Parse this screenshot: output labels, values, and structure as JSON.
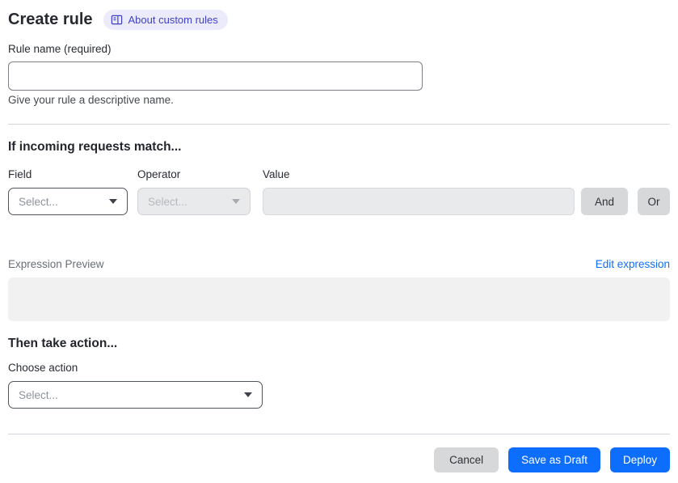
{
  "page": {
    "title": "Create rule",
    "about_badge": {
      "label": "About custom rules",
      "icon": "book-icon"
    }
  },
  "colors": {
    "accent_blue": "#0d6efd",
    "link_blue": "#0d6efd",
    "badge_bg": "#ecebfb",
    "badge_text": "#4141c8",
    "disabled_bg": "#e9eaec",
    "gray_button_bg": "#d7d8da",
    "expression_box_bg": "#f1f1f2"
  },
  "rule_name": {
    "label": "Rule name (required)",
    "value": "",
    "helper": "Give your rule a descriptive name."
  },
  "match_section": {
    "heading": "If incoming requests match...",
    "field": {
      "label": "Field",
      "placeholder": "Select...",
      "disabled": false
    },
    "operator": {
      "label": "Operator",
      "placeholder": "Select...",
      "disabled": true
    },
    "value": {
      "label": "Value",
      "value": "",
      "disabled": true
    },
    "and_label": "And",
    "or_label": "Or",
    "expression": {
      "label": "Expression Preview",
      "edit_link": "Edit expression",
      "content": ""
    }
  },
  "action_section": {
    "heading": "Then take action...",
    "choose_label": "Choose action",
    "placeholder": "Select..."
  },
  "footer": {
    "cancel_label": "Cancel",
    "save_draft_label": "Save as Draft",
    "deploy_label": "Deploy"
  }
}
